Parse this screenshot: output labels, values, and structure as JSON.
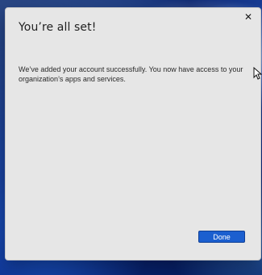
{
  "dialog": {
    "title": "You’re all set!",
    "message": "We’ve added your account successfully. You now have access to your organization’s apps and services.",
    "done_label": "Done",
    "close_glyph": "✕"
  },
  "icons": {
    "close": "close-icon",
    "cursor": "mouse-cursor-icon"
  },
  "colors": {
    "dialog_background": "#e6e6e6",
    "primary_button": "#1b5fcf"
  }
}
